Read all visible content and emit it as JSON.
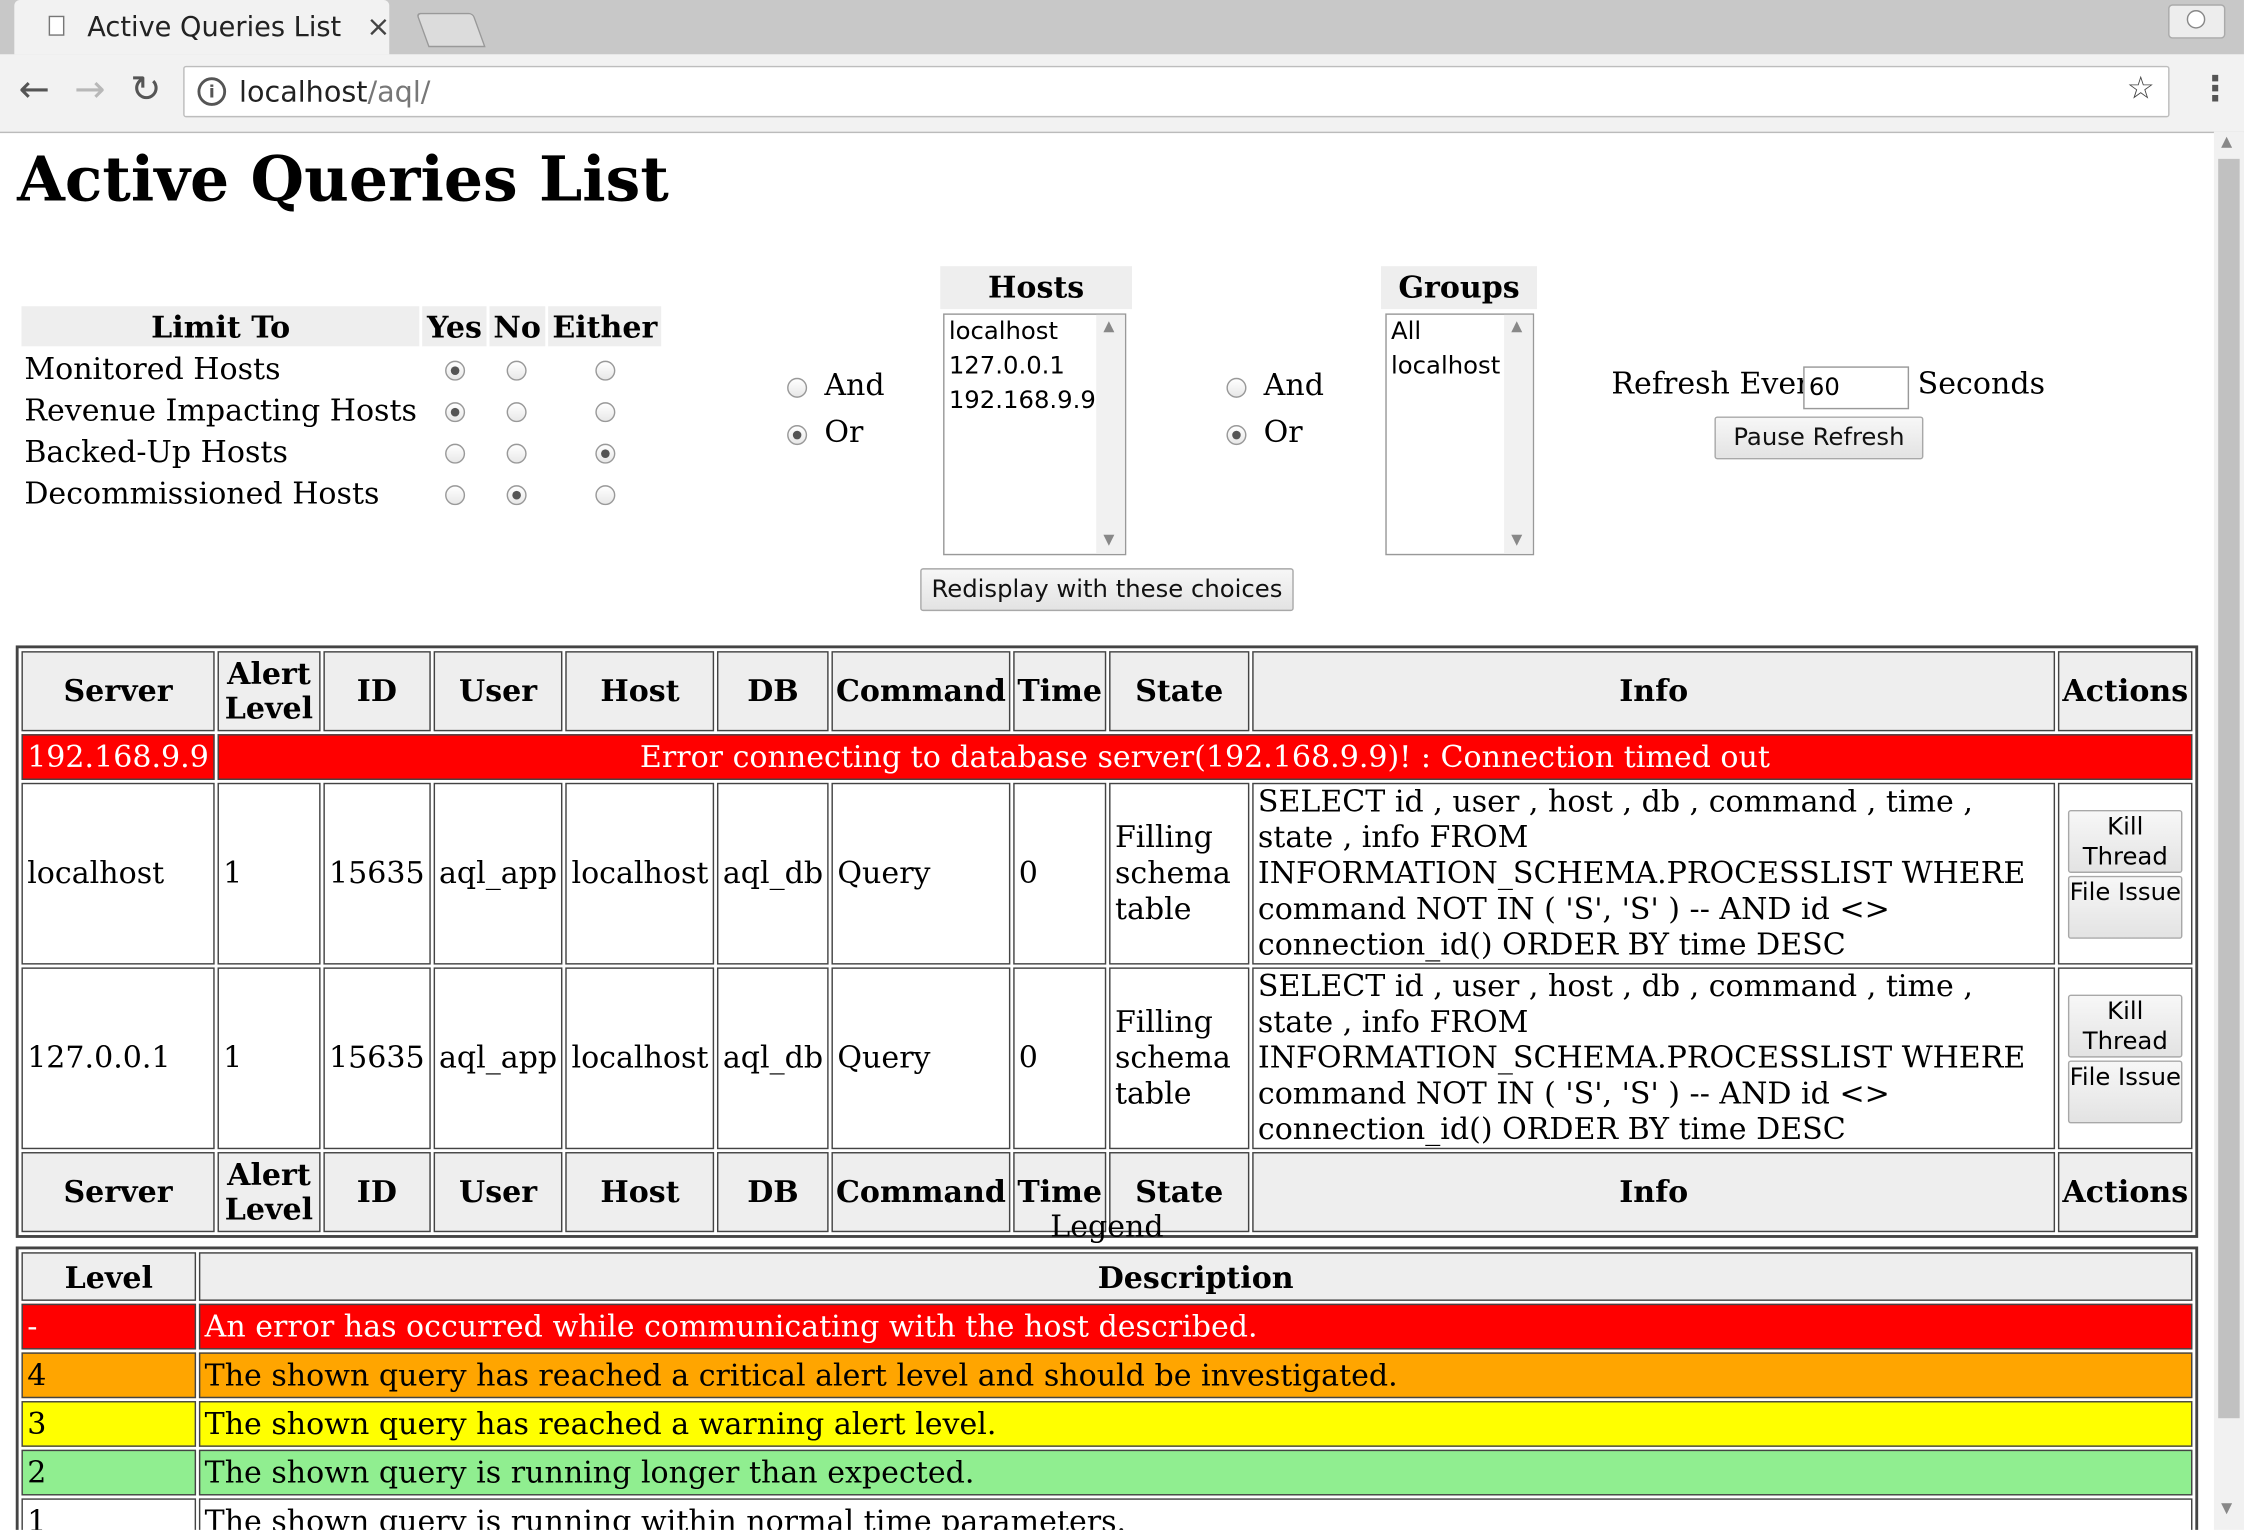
{
  "browser": {
    "tab_title": "Active Queries List",
    "tab_close": "×",
    "url_host": "localhost",
    "url_path": "/aql/",
    "icons": [
      "page-icon",
      "close-icon",
      "back-icon",
      "forward-icon",
      "reload-icon",
      "info-icon",
      "star-icon",
      "menu-icon",
      "profile-icon"
    ]
  },
  "page": {
    "title": "Active Queries List"
  },
  "limit_to": {
    "header": "Limit To",
    "col_yes": "Yes",
    "col_no": "No",
    "col_either": "Either",
    "rows": [
      {
        "label": "Monitored Hosts",
        "selected": "Yes"
      },
      {
        "label": "Revenue Impacting Hosts",
        "selected": "Yes"
      },
      {
        "label": "Backed-Up Hosts",
        "selected": "Either"
      },
      {
        "label": "Decommissioned Hosts",
        "selected": "No"
      }
    ]
  },
  "logic_1": {
    "and_label": "And",
    "or_label": "Or",
    "selected": "Or"
  },
  "logic_2": {
    "and_label": "And",
    "or_label": "Or",
    "selected": "Or"
  },
  "hosts": {
    "title": "Hosts",
    "options": [
      "localhost",
      "127.0.0.1",
      "192.168.9.9"
    ]
  },
  "groups": {
    "title": "Groups",
    "options": [
      "All",
      "localhost"
    ]
  },
  "redisplay_label": "Redisplay with these choices",
  "refresh": {
    "label": "Refresh Every",
    "value": "60",
    "unit": "Seconds",
    "pause_label": "Pause Refresh"
  },
  "queries": {
    "headers": {
      "server": "Server",
      "alert_level": "Alert Level",
      "id": "ID",
      "user": "User",
      "host": "Host",
      "db": "DB",
      "command": "Command",
      "time": "Time",
      "state": "State",
      "info": "Info",
      "actions": "Actions"
    },
    "error_row": {
      "server": "192.168.9.9",
      "message": "Error connecting to database server(192.168.9.9)! : Connection timed out",
      "color": "#ff0000"
    },
    "rows": [
      {
        "server": "localhost",
        "alert_level": "1",
        "id": "15635",
        "user": "aql_app",
        "host": "localhost",
        "db": "aql_db",
        "command": "Query",
        "time": "0",
        "state": "Filling schema table",
        "info": "SELECT id , user , host , db , command , time , state , info FROM INFORMATION_SCHEMA.PROCESSLIST WHERE command NOT IN ( 'S', 'S' ) -- AND id <> connection_id() ORDER BY time DESC",
        "kill_label": "Kill Thread",
        "file_label": "File Issue"
      },
      {
        "server": "127.0.0.1",
        "alert_level": "1",
        "id": "15635",
        "user": "aql_app",
        "host": "localhost",
        "db": "aql_db",
        "command": "Query",
        "time": "0",
        "state": "Filling schema table",
        "info": "SELECT id , user , host , db , command , time , state , info FROM INFORMATION_SCHEMA.PROCESSLIST WHERE command NOT IN ( 'S', 'S' ) -- AND id <> connection_id() ORDER BY time DESC",
        "kill_label": "Kill Thread",
        "file_label": "File Issue"
      }
    ]
  },
  "legend": {
    "caption": "Legend",
    "col_level": "Level",
    "col_description": "Description",
    "rows": [
      {
        "level": "-",
        "description": "An error has occurred while communicating with the host described.",
        "color": "#ff0000",
        "text_color": "#ffffff"
      },
      {
        "level": "4",
        "description": "The shown query has reached a critical alert level and should be investigated.",
        "color": "#ffa500",
        "text_color": "#000000"
      },
      {
        "level": "3",
        "description": "The shown query has reached a warning alert level.",
        "color": "#ffff00",
        "text_color": "#000000"
      },
      {
        "level": "2",
        "description": "The shown query is running longer than expected.",
        "color": "#90ee90",
        "text_color": "#000000"
      },
      {
        "level": "1",
        "description": "The shown query is running within normal time parameters.",
        "color": "#ffffff",
        "text_color": "#000000"
      }
    ]
  }
}
